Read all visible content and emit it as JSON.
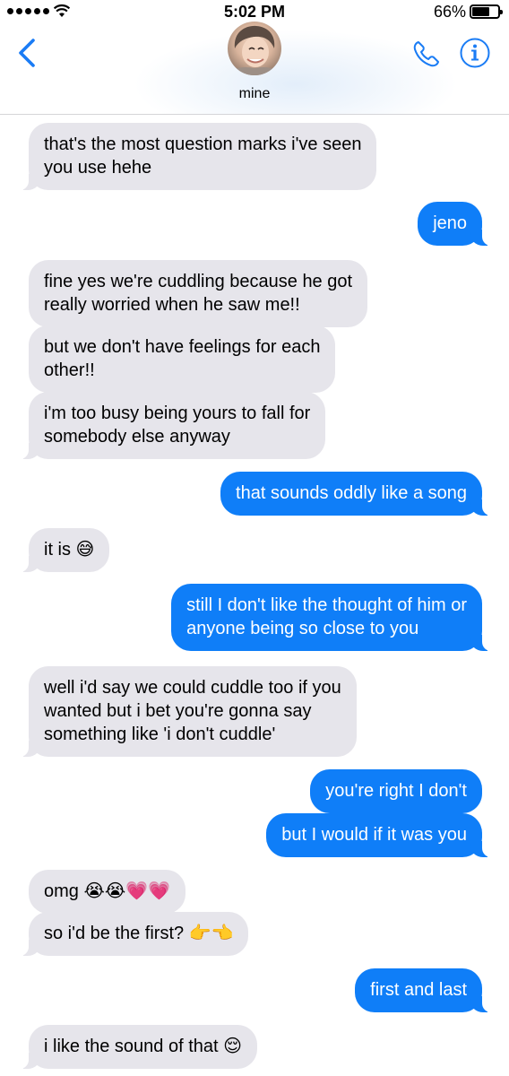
{
  "status_bar": {
    "time": "5:02 PM",
    "battery": "66%"
  },
  "header": {
    "contact_name": "mine",
    "back_icon": "chevron-left-icon",
    "phone_icon": "phone-icon",
    "info_icon": "info-icon",
    "accent_color": "#1a7cf5"
  },
  "messages": [
    {
      "from": "them",
      "text": "that's the most question marks i've seen\nyou use hehe"
    },
    {
      "from": "me",
      "text": "jeno"
    },
    {
      "from": "them",
      "text": "fine yes we're cuddling because he got\nreally worried when he saw me!!"
    },
    {
      "from": "them",
      "text": "but we don't have feelings for each\nother!!"
    },
    {
      "from": "them",
      "text": "i'm too busy being yours to fall for\nsomebody else anyway"
    },
    {
      "from": "me",
      "text": "that sounds oddly like a song"
    },
    {
      "from": "them",
      "text": "it is 😅"
    },
    {
      "from": "me",
      "text": "still I don't like the thought of him or\nanyone being so close to you"
    },
    {
      "from": "them",
      "text": "well i'd say we could cuddle too if you\nwanted but i bet you're gonna say\nsomething like 'i don't cuddle'"
    },
    {
      "from": "me",
      "text": "you're right I don't"
    },
    {
      "from": "me",
      "text": "but I would if it was you"
    },
    {
      "from": "them",
      "text": "omg 😭😭💗💗"
    },
    {
      "from": "them",
      "text": "so i'd be the first? 👉👈"
    },
    {
      "from": "me",
      "text": "first and last"
    },
    {
      "from": "them",
      "text": "i like the sound of that 😌"
    }
  ],
  "colors": {
    "incoming_bubble": "#e6e5eb",
    "outgoing_bubble": "#0f7ef8"
  }
}
